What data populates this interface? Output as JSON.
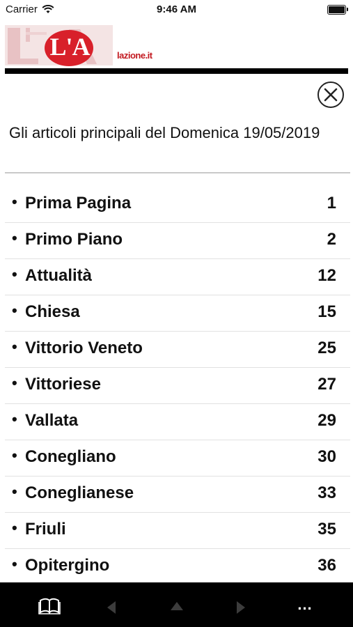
{
  "status_bar": {
    "carrier": "Carrier",
    "time": "9:46 AM",
    "battery_level": 1.0
  },
  "header": {
    "logo_text": "L'A",
    "site": "lazione.it",
    "accent_color": "#d8202a"
  },
  "toc": {
    "title": "Gli articoli principali del Domenica 19/05/2019",
    "items": [
      {
        "label": "Prima Pagina",
        "page": "1"
      },
      {
        "label": "Primo Piano",
        "page": "2"
      },
      {
        "label": "Attualità",
        "page": "12"
      },
      {
        "label": "Chiesa",
        "page": "15"
      },
      {
        "label": "Vittorio Veneto",
        "page": "25"
      },
      {
        "label": "Vittoriese",
        "page": "27"
      },
      {
        "label": "Vallata",
        "page": "29"
      },
      {
        "label": "Conegliano",
        "page": "30"
      },
      {
        "label": "Coneglianese",
        "page": "33"
      },
      {
        "label": "Friuli",
        "page": "35"
      },
      {
        "label": "Opitergino",
        "page": "36"
      }
    ]
  },
  "toolbar": {
    "icons": [
      "book-icon",
      "prev-icon",
      "up-icon",
      "next-icon",
      "more-icon"
    ],
    "more_label": "..."
  }
}
